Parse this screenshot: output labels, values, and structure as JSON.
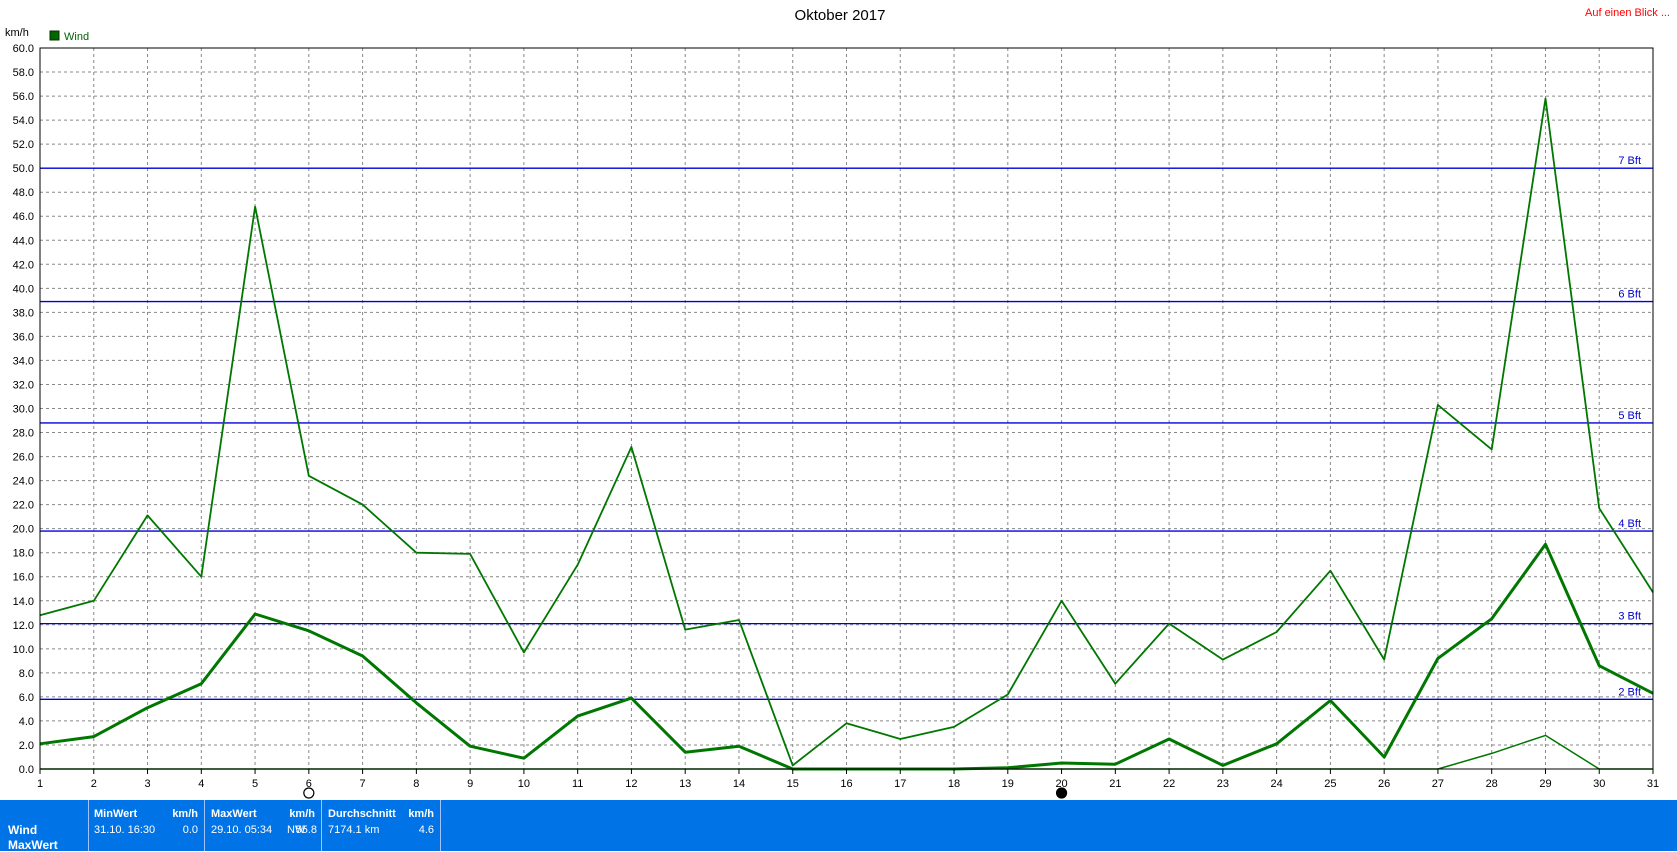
{
  "chart_data": {
    "type": "line",
    "title": "Oktober 2017",
    "ylabel": "km/h",
    "link": "Auf einen Blick ...",
    "legend": [
      "Wind"
    ],
    "ylim": [
      0,
      60
    ],
    "yticks": [
      "0.0",
      "2.0",
      "4.0",
      "6.0",
      "8.0",
      "10.0",
      "12.0",
      "14.0",
      "16.0",
      "18.0",
      "20.0",
      "22.0",
      "24.0",
      "26.0",
      "28.0",
      "30.0",
      "32.0",
      "34.0",
      "36.0",
      "38.0",
      "40.0",
      "42.0",
      "44.0",
      "46.0",
      "48.0",
      "50.0",
      "52.0",
      "54.0",
      "56.0",
      "58.0",
      "60.0"
    ],
    "x": [
      1,
      2,
      3,
      4,
      5,
      6,
      7,
      8,
      9,
      10,
      11,
      12,
      13,
      14,
      15,
      16,
      17,
      18,
      19,
      20,
      21,
      22,
      23,
      24,
      25,
      26,
      27,
      28,
      29,
      30,
      31
    ],
    "series": [
      {
        "values": [
          12.8,
          14.0,
          21.1,
          16.0,
          46.8,
          24.4,
          22.0,
          18.0,
          17.9,
          9.7,
          17.0,
          26.8,
          11.6,
          12.4,
          0.3,
          3.8,
          2.5,
          3.5,
          6.2,
          14.0,
          7.1,
          12.1,
          9.1,
          11.4,
          16.5,
          9.1,
          30.3,
          26.6,
          55.8,
          21.7,
          14.7
        ],
        "color": "#007700",
        "width": 1.8
      },
      {
        "values": [
          2.1,
          2.7,
          5.1,
          7.1,
          12.9,
          11.5,
          9.4,
          5.5,
          1.9,
          0.9,
          4.4,
          5.9,
          1.4,
          1.9,
          0.0,
          0.0,
          0.0,
          0.0,
          0.1,
          0.5,
          0.4,
          2.5,
          0.3,
          2.1,
          5.7,
          1.0,
          9.2,
          12.5,
          18.7,
          8.6,
          6.3
        ],
        "color": "#007700",
        "width": 3
      },
      {
        "values": [
          0,
          0,
          0,
          0,
          0,
          0,
          0,
          0,
          0,
          0,
          0,
          0,
          0,
          0,
          0,
          0,
          0,
          0,
          0,
          0,
          0,
          0,
          0,
          0,
          0,
          0,
          0,
          1.3,
          2.8,
          0,
          0
        ],
        "color": "#007700",
        "width": 1.5
      }
    ],
    "beaufort_lines": [
      {
        "label": "2 Bft",
        "value": 5.8
      },
      {
        "label": "3 Bft",
        "value": 12.1
      },
      {
        "label": "4 Bft",
        "value": 19.8
      },
      {
        "label": "5 Bft",
        "value": 28.8
      },
      {
        "label": "6 Bft",
        "value": 38.9
      },
      {
        "label": "7 Bft",
        "value": 50.0
      }
    ],
    "grid": true,
    "colors": {
      "line": "#007700",
      "bft": "#0000dd",
      "grid": "#888888",
      "link": "#ff0000"
    }
  },
  "stats": {
    "row1_label": "Wind",
    "row2_label": "MaxWert",
    "min": {
      "header": "MinWert",
      "unit": "km/h",
      "datetime": "31.10.  16:30",
      "value": "0.0"
    },
    "max": {
      "header": "MaxWert",
      "unit": "km/h",
      "datetime": "29.10.  05:34",
      "dir": "NW",
      "value": "55.8"
    },
    "avg": {
      "header": "Durchschnitt",
      "unit": "km/h",
      "distance": "7174.1 km",
      "value": "4.6"
    }
  }
}
